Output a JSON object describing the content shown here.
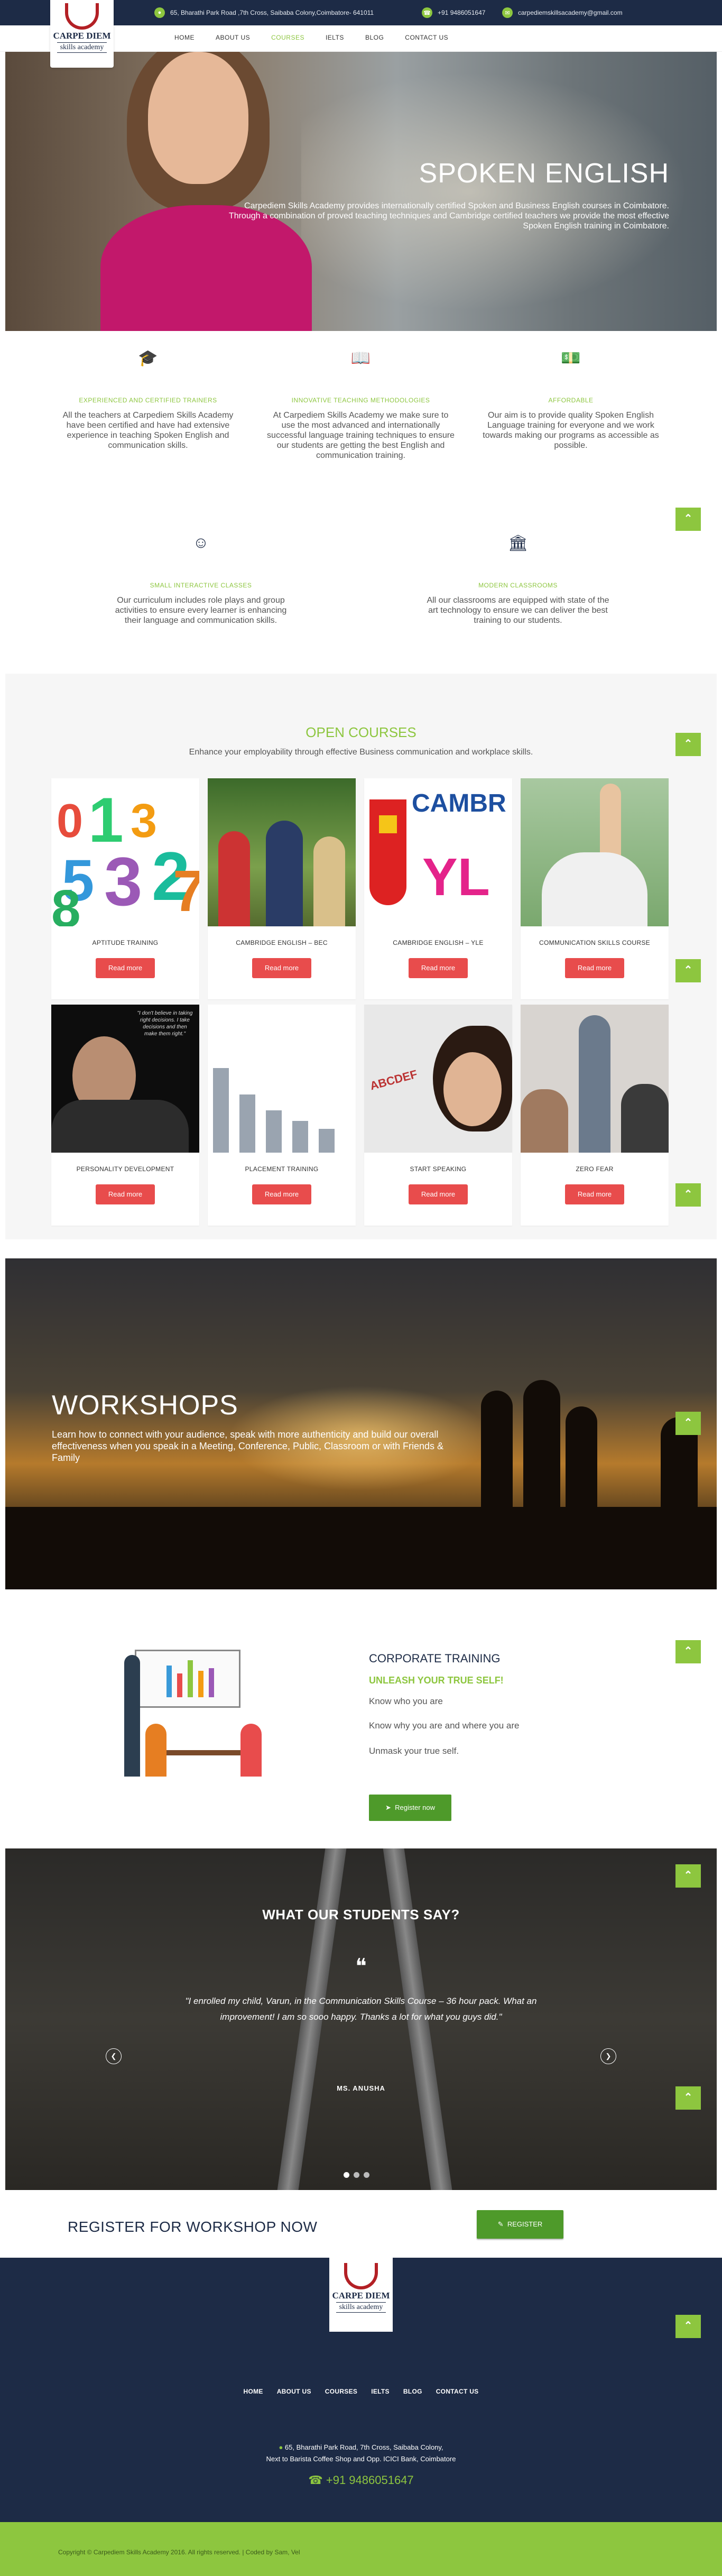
{
  "topbar": {
    "address": "65, Bharathi Park Road ,7th Cross, Saibaba Colony,Coimbatore- 641011",
    "phone": "+91 9486051647",
    "email": "carpediemskillsacademy@gmail.com"
  },
  "logo": {
    "line1": "CARPE DIEM",
    "line2": "skills academy"
  },
  "nav": [
    "HOME",
    "ABOUT US",
    "COURSES",
    "IELTS",
    "BLOG",
    "CONTACT US"
  ],
  "hero": {
    "title": "SPOKEN ENGLISH",
    "text": "Carpediem Skills Academy provides internationally certified Spoken and Business English courses in Coimbatore. Through a combination of proved teaching techniques and Cambridge certified teachers we provide the most effective Spoken English training in Coimbatore."
  },
  "features": [
    {
      "icon": "graduation-cap-icon",
      "title": "EXPERIENCED AND CERTIFIED TRAINERS",
      "text": "All the teachers at Carpediem Skills Academy have been certified and have had extensive experience in teaching Spoken English and communication skills."
    },
    {
      "icon": "book-icon",
      "title": "INNOVATIVE TEACHING METHODOLOGIES",
      "text": "At Carpediem Skills Academy we make sure to use the most advanced and internationally successful language training techniques to ensure our students are getting the best English and communication training."
    },
    {
      "icon": "money-icon",
      "title": "AFFORDABLE",
      "text": "Our aim is to provide quality Spoken English Language training for everyone and we work towards making our programs as accessible as possible."
    },
    {
      "icon": "smile-icon",
      "title": "SMALL INTERACTIVE CLASSES",
      "text": "Our curriculum includes role plays and group activities to ensure every learner is enhancing their language and communication skills."
    },
    {
      "icon": "institution-icon",
      "title": "MODERN CLASSROOMS",
      "text": "All our classrooms are equipped with state of the art technology to ensure we can deliver the best training to our students."
    }
  ],
  "courses": {
    "title": "OPEN COURSES",
    "subtitle": "Enhance your employability through effective Business communication and workplace skills.",
    "button": "Read more",
    "items": [
      "APTITUDE TRAINING",
      "CAMBRIDGE ENGLISH – BEC",
      "CAMBRIDGE ENGLISH – YLE",
      "COMMUNICATION SKILLS COURSE",
      "PERSONALITY DEVELOPMENT",
      "PLACEMENT TRAINING",
      "START SPEAKING",
      "ZERO FEAR"
    ],
    "img_text": {
      "yle_top": "CAMBR",
      "yle_bottom": "YL",
      "quote": "\"I don't believe in taking right decisions. I take decisions and then make them right.\"",
      "speak": "ABCDEF"
    }
  },
  "workshops": {
    "title": "WORKSHOPS",
    "text": "Learn how to connect with your audience, speak with more authenticity and build our overall effectiveness when you speak in a Meeting, Conference, Public, Classroom or with Friends & Family"
  },
  "corporate": {
    "title": "CORPORATE TRAINING",
    "subtitle": "UNLEASH YOUR TRUE SELF!",
    "lines": [
      "Know who you are",
      "Know why you are and where you are",
      "Unmask your true self."
    ],
    "button": "Register now"
  },
  "testimonial": {
    "title": "WHAT OUR STUDENTS SAY?",
    "text": "\"I enrolled my child, Varun, in the Communication Skills Course – 36 hour pack. What an improvement! I am so sooo happy. Thanks a lot for what you guys did.\"",
    "name": "MS. ANUSHA"
  },
  "register": {
    "title": "REGISTER FOR WORKSHOP NOW",
    "button": "REGISTER"
  },
  "footer": {
    "nav": [
      "HOME",
      "ABOUT US",
      "COURSES",
      "IELTS",
      "BLOG",
      "CONTACT US"
    ],
    "address_line1": "65, Bharathi Park Road, 7th Cross, Saibaba Colony,",
    "address_line2": "Next to Barista Coffee Shop and Opp. ICICI Bank, Coimbatore",
    "phone": "+91 9486051647",
    "copyright": "Copyright © Carpediem Skills Academy 2016. All rights reserved. | Coded by Sam, Vel"
  },
  "colors": {
    "navy": "#1d2b46",
    "green": "#8dc63f",
    "red": "#e84c4c",
    "dark_green": "#4e9a2a"
  }
}
